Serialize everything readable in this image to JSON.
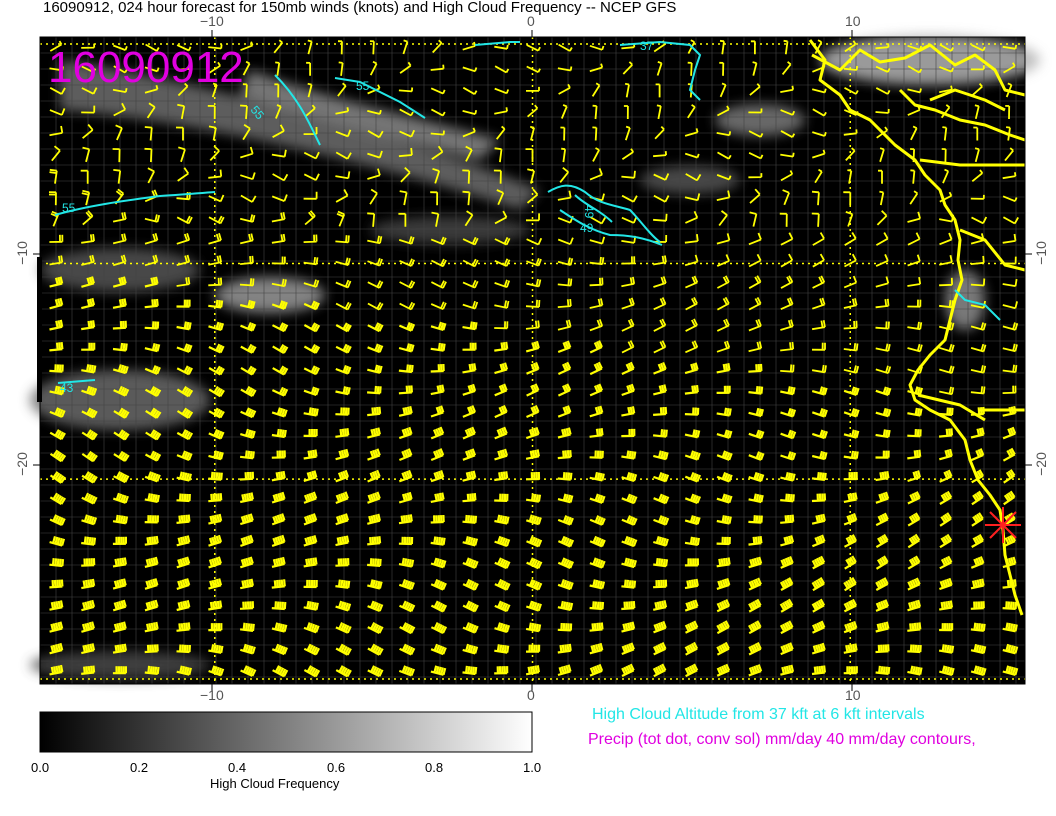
{
  "title": "16090912, 024 hour forecast for 150mb winds (knots) and High Cloud Frequency -- NCEP GFS",
  "stamp": "16090912",
  "x_ticks": [
    "−10",
    "0",
    "10"
  ],
  "y_ticks": [
    "−10",
    "−20"
  ],
  "contour_labels": [
    "37",
    "55",
    "55",
    "55",
    "43",
    "49",
    "49"
  ],
  "legend": {
    "line1": "High Cloud Altitude from 37 kft at 6 kft intervals",
    "line2": "Precip (tot dot, conv sol) mm/day 40 mm/day contours,"
  },
  "colorbar": {
    "title": "High Cloud Frequency",
    "labels": [
      "0.0",
      "0.2",
      "0.4",
      "0.6",
      "0.8",
      "1.0"
    ]
  },
  "colors": {
    "background": "#000000",
    "barbs": "#ffff00",
    "coast": "#ffff00",
    "contours": "#22e6e6",
    "stamp": "#e000e0",
    "marker": "#ff2020"
  },
  "grid": {
    "lon_range": [
      -15.5,
      15.5
    ],
    "lat_range": [
      -29.5,
      0.5
    ],
    "lon_lines": [
      -10,
      0,
      10
    ],
    "lat_lines": [
      -10,
      -20
    ]
  }
}
